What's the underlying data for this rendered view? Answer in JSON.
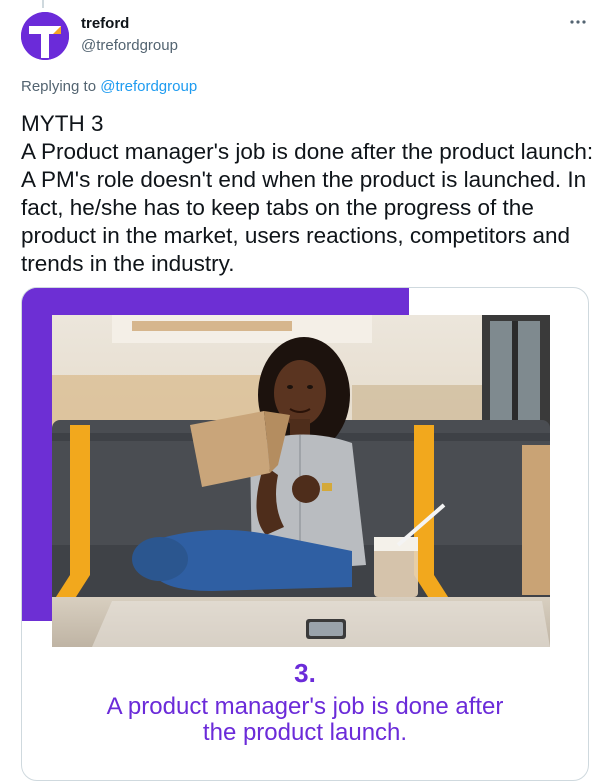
{
  "author": {
    "name": "treford",
    "handle": "@trefordgroup",
    "avatar_letter": "T"
  },
  "more_icon": "more-horizontal-icon",
  "replying": {
    "prefix": "Replying to ",
    "mention": "@trefordgroup"
  },
  "tweet": {
    "text": "MYTH 3\nA Product manager's job is done after the product launch: A PM's role doesn't end when the product is launched. In fact, he/she has to keep tabs on the progress of the product in the market, users reactions, competitors and trends in the industry."
  },
  "media": {
    "number": "3.",
    "caption": "A product manager's job is done after\nthe product launch."
  },
  "colors": {
    "brand_purple": "#6b2bd9",
    "link_blue": "#1d9bf0",
    "muted_text": "#536471",
    "border": "#cfd9de"
  }
}
